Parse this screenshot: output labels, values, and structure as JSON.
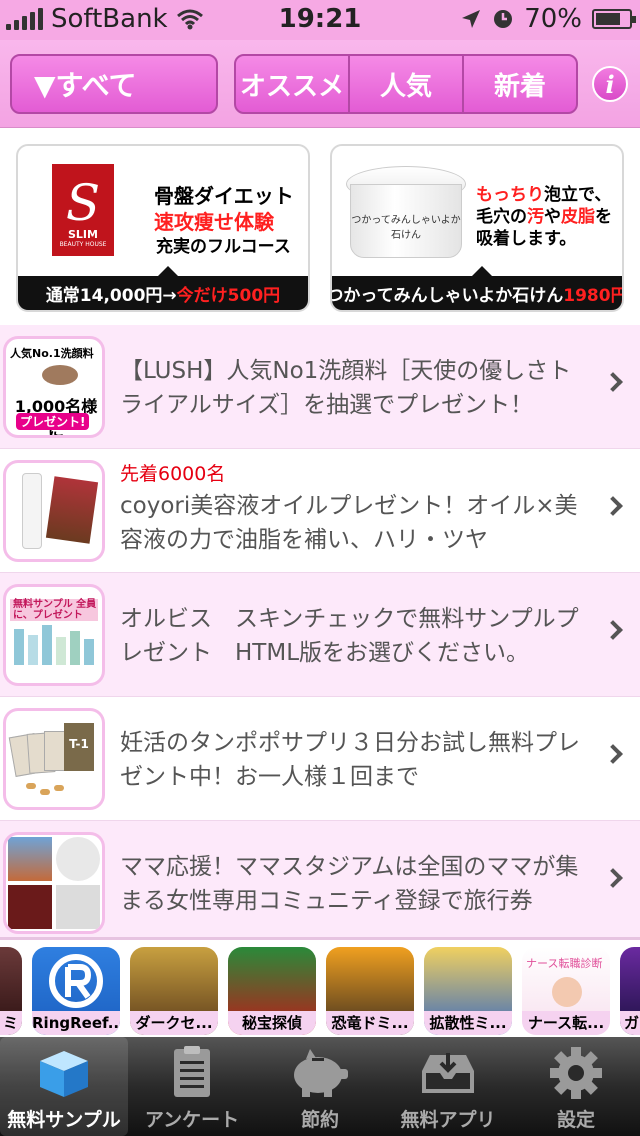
{
  "status_bar": {
    "carrier": "SoftBank",
    "time": "19:21",
    "battery": "70%"
  },
  "header": {
    "filter_label": "▼すべて",
    "segments": [
      "オススメ",
      "人気",
      "新着"
    ],
    "info_label": "i"
  },
  "banners": [
    {
      "brand_initial": "S",
      "brand_name": "SLIM",
      "brand_sub": "BEAUTY HOUSE",
      "line1": "骨盤ダイエット",
      "line2": "速攻痩せ体験",
      "line3": "充実のフルコース",
      "caption_prefix": "通常14,000円→",
      "caption_highlight": "今だけ500円"
    },
    {
      "jar_text": "つかってみんしゃいよか石けん",
      "line1_red": "もっちり",
      "line1": "泡立で、",
      "line2_pre": "毛穴の",
      "line2_red1": "汚",
      "line2_mid": "や",
      "line2_red2": "皮脂",
      "line2_post": "を",
      "line3": "吸着します。",
      "caption_prefix": "つかってみんしゃいよか石けん",
      "caption_highlight": "1980円"
    }
  ],
  "list": [
    {
      "thumb_top": "人気No.1洗顔料",
      "thumb_big": "1,000名様に",
      "thumb_tag": "プレゼント!",
      "text": "【LUSH】人気No1洗顔料［天使の優しさトライアルサイズ］を抽選でプレゼント！"
    },
    {
      "tag": "先着6000名",
      "text": "coyori美容液オイルプレゼント！オイル×美容液の力で油脂を補い、ハリ・ツヤ"
    },
    {
      "thumb_band": "無料サンプル 全員に、プレゼント",
      "text": "オルビス　スキンチェックで無料サンプルプレゼント　HTML版をお選びください。"
    },
    {
      "thumb_label": "T-1",
      "text": "妊活のタンポポサプリ３日分お試し無料プレゼント中！お一人様１回まで"
    },
    {
      "text": "ママ応援！ママスタジアムは全国のママが集まる女性専用コミュニティ登録で旅行券"
    }
  ],
  "apps": [
    "ミ",
    "RingReef...",
    "ダークセ...",
    "秘宝探偵",
    "恐竜ドミ...",
    "拡散性ミ...",
    "ナース転...",
    "ガ"
  ],
  "app_nurse_banner": "ナース転職診断",
  "tabs": [
    {
      "label": "無料サンプル",
      "icon": "box-icon"
    },
    {
      "label": "アンケート",
      "icon": "clipboard-icon"
    },
    {
      "label": "節約",
      "icon": "piggy-bank-icon"
    },
    {
      "label": "無料アプリ",
      "icon": "download-tray-icon"
    },
    {
      "label": "設定",
      "icon": "gear-icon"
    }
  ],
  "colors": {
    "header_pink": "#f3a3e3",
    "button_magenta": "#e35cd4",
    "row_pink": "#fde9fa",
    "accent_red": "#ff2020",
    "tab_bar_dark": "#2a2a2a"
  }
}
